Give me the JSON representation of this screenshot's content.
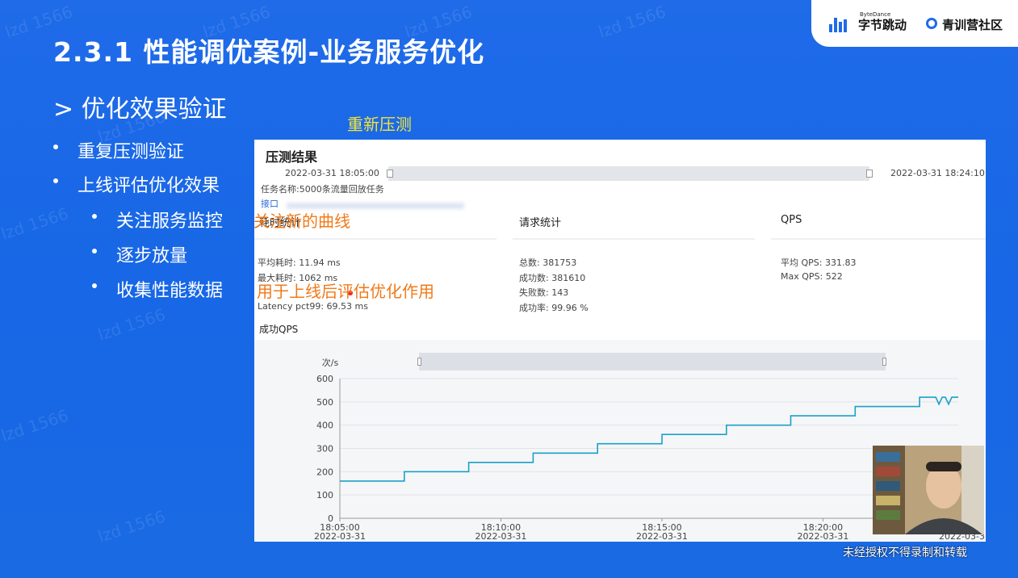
{
  "brand": {
    "bytedance_small": "ByteDance",
    "bytedance": "字节跳动",
    "community": "青训营社区"
  },
  "slide": {
    "title": "2.3.1 性能调优案例-业务服务优化",
    "subheading": "> 优化效果验证",
    "bullets": [
      {
        "text": "重复压测验证",
        "level": 1
      },
      {
        "text": "上线评估优化效果",
        "level": 1
      },
      {
        "text": "关注服务监控",
        "level": 2
      },
      {
        "text": "逐步放量",
        "level": 2
      },
      {
        "text": "收集性能数据",
        "level": 2
      }
    ]
  },
  "annotations": {
    "rerun": "重新压测",
    "watch_curve": "关注新的曲线",
    "evaluate": "用于上线后评估优化作用"
  },
  "colors": {
    "annotation_yellow": "#f3e53a",
    "annotation_orange": "#f07a1a",
    "line": "#1aa1c8"
  },
  "panel": {
    "title": "压测结果",
    "start_time": "2022-03-31 18:05:00",
    "end_time": "2022-03-31 18:24:10",
    "task_name": "任务名称:5000条流量回放任务",
    "interface_label": "接口",
    "latency": {
      "header": "耗时统计",
      "avg": "平均耗时: 11.94 ms",
      "max": "最大耗时: 1062 ms",
      "pct99": "Latency pct99: 69.53 ms"
    },
    "requests": {
      "header": "请求统计",
      "total": "总数: 381753",
      "success": "成功数: 381610",
      "failed": "失败数: 143",
      "rate": "成功率: 99.96 %"
    },
    "qps": {
      "header": "QPS",
      "avg": "平均 QPS: 331.83",
      "max": "Max QPS: 522"
    },
    "chart_title": "成功QPS"
  },
  "chart_data": {
    "type": "line",
    "title": "成功QPS",
    "ylabel": "次/s",
    "ylim": [
      0,
      600
    ],
    "yticks": [
      0,
      100,
      200,
      300,
      400,
      500,
      600
    ],
    "xticks": [
      {
        "time": "18:05:00",
        "date": "2022-03-31"
      },
      {
        "time": "18:10:00",
        "date": "2022-03-31"
      },
      {
        "time": "18:15:00",
        "date": "2022-03-31"
      },
      {
        "time": "18:20:00",
        "date": "2022-03-31"
      },
      {
        "time": "",
        "date": "2022-03-31"
      }
    ],
    "x_minutes_range": [
      0,
      19.2
    ],
    "series": [
      {
        "points": [
          [
            0,
            160
          ],
          [
            2,
            160
          ],
          [
            2,
            200
          ],
          [
            4,
            200
          ],
          [
            4,
            240
          ],
          [
            6,
            240
          ],
          [
            6,
            280
          ],
          [
            8,
            280
          ],
          [
            8,
            320
          ],
          [
            10,
            320
          ],
          [
            10,
            360
          ],
          [
            12,
            360
          ],
          [
            12,
            400
          ],
          [
            14,
            400
          ],
          [
            14,
            440
          ],
          [
            16,
            440
          ],
          [
            16,
            480
          ],
          [
            18,
            480
          ],
          [
            18,
            520
          ],
          [
            18.5,
            520
          ],
          [
            18.6,
            490
          ],
          [
            18.7,
            520
          ],
          [
            18.8,
            520
          ],
          [
            18.9,
            490
          ],
          [
            19.0,
            520
          ],
          [
            19.2,
            520
          ]
        ]
      }
    ]
  },
  "caption": "未经授权不得录制和转载"
}
